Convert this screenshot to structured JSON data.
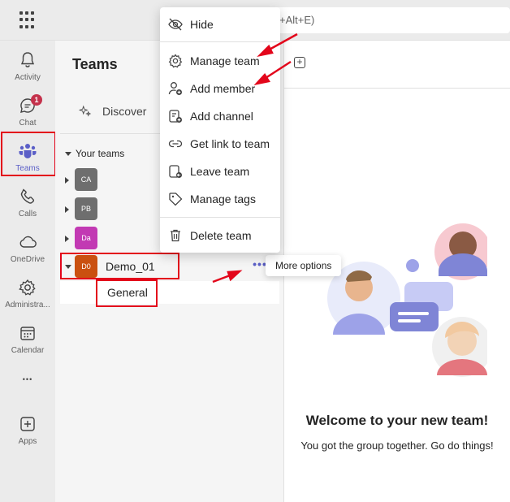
{
  "topbar": {
    "search_hint": "+Alt+E)"
  },
  "rail": {
    "items": [
      {
        "label": "Activity"
      },
      {
        "label": "Chat",
        "badge": "1"
      },
      {
        "label": "Teams"
      },
      {
        "label": "Calls"
      },
      {
        "label": "OneDrive"
      },
      {
        "label": "Administra..."
      },
      {
        "label": "Calendar"
      },
      {
        "label": "Apps"
      }
    ],
    "more_glyph": "•••"
  },
  "panel": {
    "title": "Teams",
    "discover_label": "Discover",
    "your_teams_label": "Your teams",
    "teams": [
      {
        "initials": "CA",
        "name": "",
        "color": "#6e6e6e"
      },
      {
        "initials": "PB",
        "name": "",
        "color": "#6e6e6e"
      },
      {
        "initials": "Da",
        "name": "",
        "color": "#c239b3"
      },
      {
        "initials": "D0",
        "name": "Demo_01",
        "color": "#ca5010"
      }
    ],
    "more_options_glyph": "•••",
    "channel": "General"
  },
  "tooltip": {
    "text": "More options"
  },
  "menu": {
    "items": [
      {
        "label": "Hide",
        "icon": "hide-icon"
      },
      {
        "label": "Manage team",
        "icon": "gear-icon"
      },
      {
        "label": "Add member",
        "icon": "add-person-icon"
      },
      {
        "label": "Add channel",
        "icon": "add-channel-icon"
      },
      {
        "label": "Get link to team",
        "icon": "link-icon"
      },
      {
        "label": "Leave team",
        "icon": "leave-icon"
      },
      {
        "label": "Manage tags",
        "icon": "tag-icon"
      },
      {
        "label": "Delete team",
        "icon": "trash-icon"
      }
    ]
  },
  "content": {
    "plus_glyph": "+",
    "welcome_title": "Welcome to your new team!",
    "welcome_subtitle": "You got the group together. Go do things!"
  },
  "colors": {
    "accent": "#5b5fc7",
    "annotation": "#e3061b"
  }
}
